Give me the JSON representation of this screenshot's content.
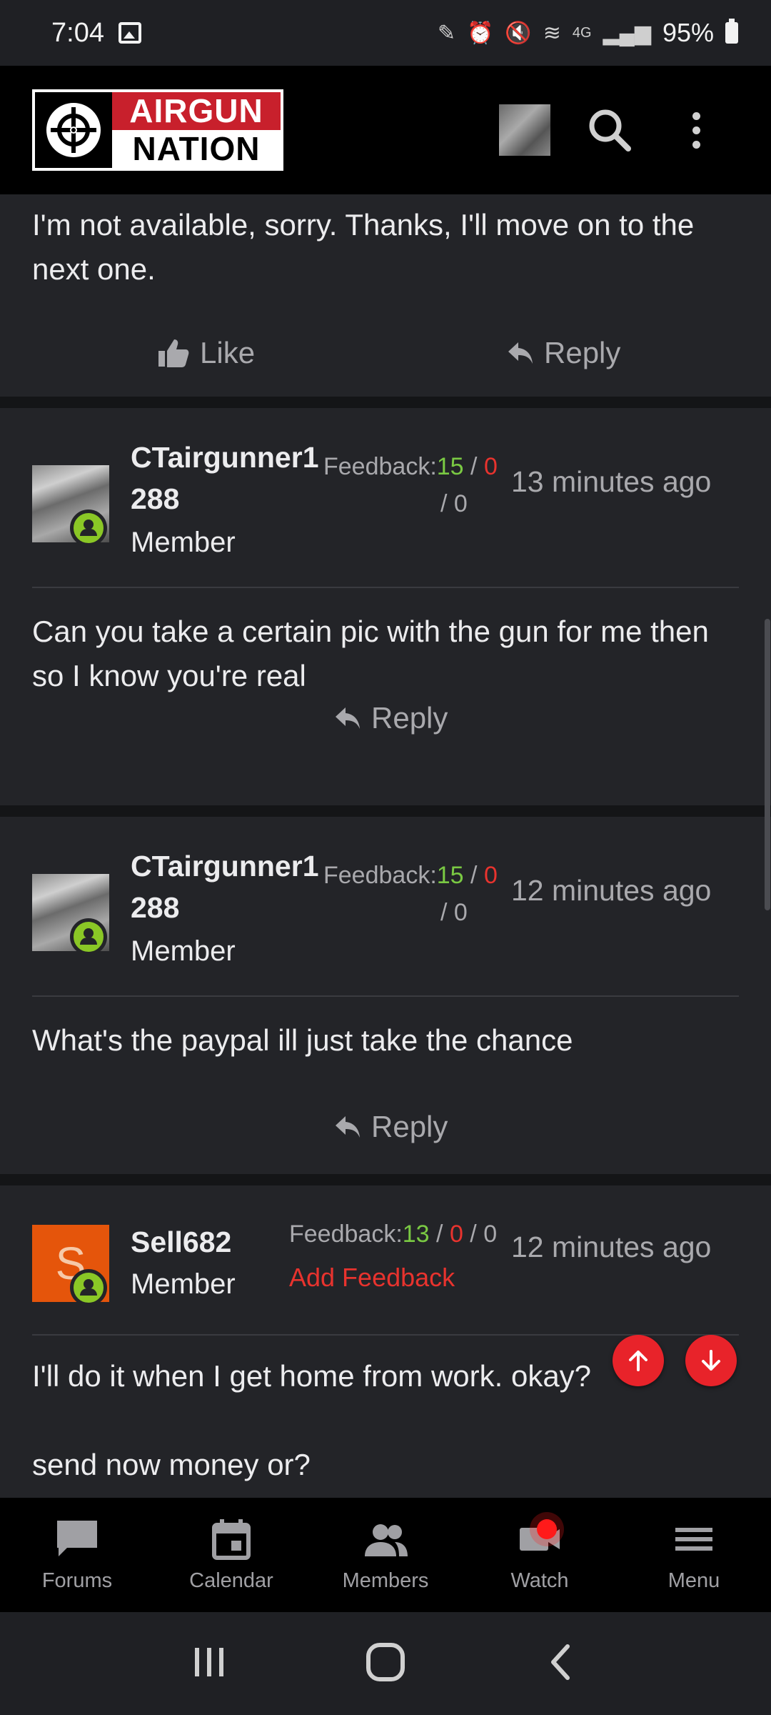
{
  "status_bar": {
    "time": "7:04",
    "battery": "95%",
    "network": "4G"
  },
  "header": {
    "logo_line1": "AIRGUN",
    "logo_line2": "NATION"
  },
  "posts": [
    {
      "text": "I'm not available, sorry. Thanks, I'll move on to the next one.",
      "like_label": "Like",
      "reply_label": "Reply"
    },
    {
      "username_line1": "CTairgunner1",
      "username_line2": "288",
      "role": "Member",
      "feedback_label": "Feedback:",
      "feedback_pos": "15",
      "feedback_neg": "0",
      "feedback_neutral": "0",
      "time": "13 minutes ago",
      "text": "Can you take a certain pic with the gun for me then so I know you're real",
      "reply_label": "Reply"
    },
    {
      "username_line1": "CTairgunner1",
      "username_line2": "288",
      "role": "Member",
      "feedback_label": "Feedback:",
      "feedback_pos": "15",
      "feedback_neg": "0",
      "feedback_neutral": "0",
      "time": "12 minutes ago",
      "text": "What's the paypal ill just take the chance",
      "reply_label": "Reply"
    },
    {
      "avatar_letter": "S",
      "username": "Sell682",
      "role": "Member",
      "feedback_label": "Feedback:",
      "feedback_pos": "13",
      "feedback_neg": "0",
      "feedback_neutral": "0",
      "add_feedback": "Add Feedback",
      "time": "12 minutes ago",
      "text_line1": "I'll do it when I get home from work. okay?",
      "text_line2": "send now money or?"
    }
  ],
  "bottom_nav": [
    {
      "label": "Forums",
      "icon": "forums-icon"
    },
    {
      "label": "Calendar",
      "icon": "calendar-icon"
    },
    {
      "label": "Members",
      "icon": "members-icon"
    },
    {
      "label": "Watch",
      "icon": "video-icon"
    },
    {
      "label": "Menu",
      "icon": "menu-icon"
    }
  ],
  "colors": {
    "accent_red": "#e8232a",
    "feedback_positive": "#7ac943",
    "online": "#8ac726"
  }
}
